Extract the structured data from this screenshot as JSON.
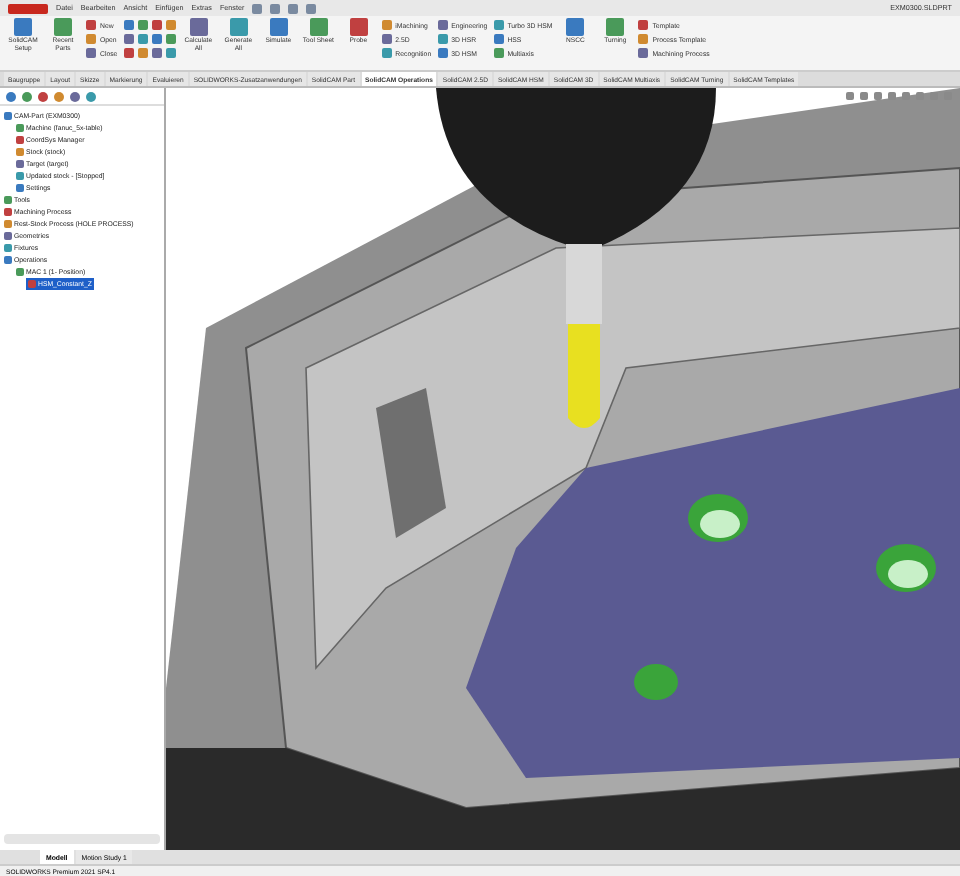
{
  "title_bar": {
    "menu": [
      "Datei",
      "Bearbeiten",
      "Ansicht",
      "Einfügen",
      "Extras",
      "Fenster"
    ],
    "document": "EXM0300.SLDPRT"
  },
  "ribbon": [
    {
      "kind": "large",
      "label": "SolidCAM Setup"
    },
    {
      "kind": "large",
      "label": "Recent Parts"
    },
    {
      "kind": "stack",
      "items": [
        "New",
        "Open",
        "Close"
      ]
    },
    {
      "kind": "icons"
    },
    {
      "kind": "large",
      "label": "Calculate All"
    },
    {
      "kind": "large",
      "label": "Generate All"
    },
    {
      "kind": "large",
      "label": "Simulate"
    },
    {
      "kind": "large",
      "label": "Tool Sheet"
    },
    {
      "kind": "large",
      "label": "Probe"
    },
    {
      "kind": "stack",
      "items": [
        "iMachining",
        "2.5D",
        "Recognition"
      ]
    },
    {
      "kind": "stack",
      "items": [
        "Engineering",
        "3D HSR",
        "3D HSM"
      ]
    },
    {
      "kind": "stack",
      "items": [
        "Turbo 3D HSM",
        "HSS",
        "Multiaxis"
      ]
    },
    {
      "kind": "large",
      "label": "NSCC"
    },
    {
      "kind": "large",
      "label": "Turning"
    },
    {
      "kind": "stack",
      "items": [
        "Template",
        "Process Template",
        "Machining Process"
      ]
    }
  ],
  "tabs": [
    {
      "label": "Baugruppe",
      "selected": false
    },
    {
      "label": "Layout",
      "selected": false
    },
    {
      "label": "Skizze",
      "selected": false
    },
    {
      "label": "Markierung",
      "selected": false
    },
    {
      "label": "Evaluieren",
      "selected": false
    },
    {
      "label": "SOLIDWORKS-Zusatzanwendungen",
      "selected": false
    },
    {
      "label": "SolidCAM Part",
      "selected": false
    },
    {
      "label": "SolidCAM Operations",
      "selected": true
    },
    {
      "label": "SolidCAM 2.5D",
      "selected": false
    },
    {
      "label": "SolidCAM HSM",
      "selected": false
    },
    {
      "label": "SolidCAM 3D",
      "selected": false
    },
    {
      "label": "SolidCAM Multiaxis",
      "selected": false
    },
    {
      "label": "SolidCAM Turning",
      "selected": false
    },
    {
      "label": "SolidCAM Templates",
      "selected": false
    }
  ],
  "tree": [
    {
      "label": "CAM-Part (EXM0300)",
      "selected": false,
      "children": [
        {
          "label": "Machine (fanuc_5x-table)",
          "selected": false
        },
        {
          "label": "CoordSys Manager",
          "selected": false
        },
        {
          "label": "Stock (stock)",
          "selected": false
        },
        {
          "label": "Target (target)",
          "selected": false
        },
        {
          "label": "Updated stock - [Stopped]",
          "selected": false
        },
        {
          "label": "Settings",
          "selected": false
        }
      ]
    },
    {
      "label": "Tools",
      "selected": false
    },
    {
      "label": "Machining Process",
      "selected": false
    },
    {
      "label": "Rest-Stock Process (HOLE PROCESS)",
      "selected": false
    },
    {
      "label": "Geometries",
      "selected": false
    },
    {
      "label": "Fixtures",
      "selected": false
    },
    {
      "label": "Operations",
      "selected": false,
      "children": [
        {
          "label": "MAC 1 (1- Position)",
          "selected": false,
          "children": [
            {
              "label": "HSM_Constant_Z",
              "selected": true
            }
          ]
        }
      ]
    }
  ],
  "bottom_tabs": [
    {
      "label": "Modell",
      "selected": true
    },
    {
      "label": "Motion Study 1",
      "selected": false
    }
  ],
  "status_bar": "SOLIDWORKS Premium 2021 SP4.1"
}
